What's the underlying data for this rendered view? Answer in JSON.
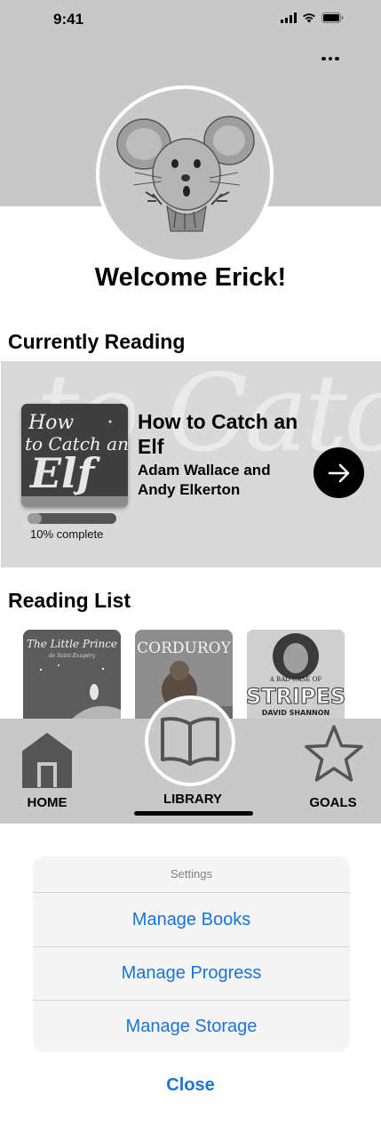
{
  "status_bar": {
    "time": "9:41"
  },
  "header": {
    "welcome": "Welcome Erick!"
  },
  "currently_reading": {
    "section_title": "Currently Reading",
    "book": {
      "title": "How to Catch an Elf",
      "author": "Adam Wallace and Andy Elkerton",
      "cover_text": [
        "How",
        "to Catch an",
        "Elf"
      ],
      "progress_fraction": 0.1,
      "progress_label": "10% complete"
    }
  },
  "reading_list": {
    "section_title": "Reading List",
    "books": [
      {
        "cover_title": "The Little Prince",
        "cover_subtitle": "de Saint-Exupéry"
      },
      {
        "cover_title": "CORDUROY"
      },
      {
        "cover_title": "STRIPES",
        "cover_subtitle": "A BAD CASE OF",
        "cover_author": "DAVID SHANNON"
      }
    ]
  },
  "tabs": {
    "home": "HOME",
    "library": "LIBRARY",
    "goals": "GOALS"
  },
  "action_sheet": {
    "title": "Settings",
    "items": [
      "Manage Books",
      "Manage Progress",
      "Manage Storage"
    ],
    "close": "Close"
  },
  "colors": {
    "header_gray": "#c8c8c8",
    "action_blue": "#1a73d9"
  },
  "icons": {
    "status": [
      "signal-icon",
      "wifi-icon",
      "battery-icon"
    ],
    "more": "more-icon",
    "next": "arrow-right-icon",
    "home": "home-icon",
    "library": "book-icon",
    "goals": "star-icon"
  }
}
